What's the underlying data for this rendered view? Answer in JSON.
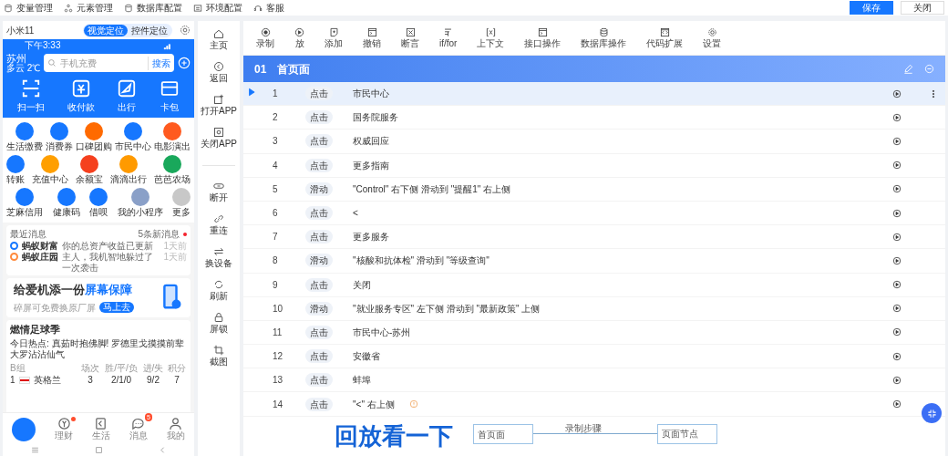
{
  "top_menu": [
    "变量管理",
    "元素管理",
    "数据库配置",
    "环境配置",
    "客服"
  ],
  "top_buttons": [
    {
      "label": "保存",
      "kind": "primary"
    },
    {
      "label": "关闭",
      "kind": "default"
    }
  ],
  "phone": {
    "device": "小米11",
    "locate_modes": [
      {
        "label": "视觉定位",
        "selected": true
      },
      {
        "label": "控件定位",
        "selected": false
      }
    ],
    "status_time": "下午3:33",
    "city": "苏州",
    "weather": "多云 2℃",
    "search_placeholder": "手机充费",
    "search_button": "搜索",
    "quick_actions": [
      "扫一扫",
      "收付款",
      "出行",
      "卡包"
    ],
    "apps": [
      [
        {
          "label": "生活缴费",
          "color": "#1677ff"
        },
        {
          "label": "消费券",
          "color": "#1677ff"
        },
        {
          "label": "口碑团购",
          "color": "#ff6a00"
        },
        {
          "label": "市民中心",
          "color": "#1677ff"
        },
        {
          "label": "电影演出",
          "color": "#ff5a1f"
        }
      ],
      [
        {
          "label": "转账",
          "color": "#1677ff"
        },
        {
          "label": "充值中心",
          "color": "#ff9f00"
        },
        {
          "label": "余额宝",
          "color": "#f5401e"
        },
        {
          "label": "滴滴出行",
          "color": "#ff9a00"
        },
        {
          "label": "芭芭农场",
          "color": "#19a85b"
        }
      ],
      [
        {
          "label": "芝麻信用",
          "color": "#1677ff"
        },
        {
          "label": "健康码",
          "color": "#1677ff"
        },
        {
          "label": "借呗",
          "color": "#1677ff"
        },
        {
          "label": "我的小程序",
          "color": "#8aa0c8"
        },
        {
          "label": "更多",
          "color": "#c8c8c8"
        }
      ]
    ],
    "messages": {
      "title": "最近消息",
      "count": "5条新消息",
      "items": [
        {
          "source": "蚂蚁财富",
          "text": "你的总资产收益已更新",
          "time": "1天前",
          "color": "#1677ff"
        },
        {
          "source": "蚂蚁庄园",
          "text": "主人，我机智地躲过了一次袭击",
          "time": "1天前",
          "color": "#ff8a3d"
        }
      ]
    },
    "banner": {
      "title": "给爱机添一份",
      "title_highlight": "屏幕保障",
      "subtitle": "碎屏可免费换原厂屏",
      "button": "马上去"
    },
    "sports": {
      "title": "燃情足球季",
      "headline": "今日热点: 真茹时抱佛脚! 罗德里戈摸摸前辈大罗沾沾仙气",
      "group": "B组",
      "columns": [
        "场次",
        "胜/平/负",
        "进/失",
        "积分"
      ],
      "rows": [
        {
          "rank": "1",
          "team": "英格兰",
          "values": [
            "3",
            "2/1/0",
            "9/2",
            "7"
          ]
        }
      ]
    },
    "tabbar": [
      {
        "kind": "logo"
      },
      {
        "label": "理财",
        "kind": "coin",
        "unread_dot": true
      },
      {
        "label": "生活",
        "kind": "life",
        "unread_dot": false
      },
      {
        "label": "消息",
        "kind": "chat",
        "unread_dot": false,
        "badge": "5"
      },
      {
        "label": "我的",
        "kind": "person",
        "unread_dot": false
      }
    ]
  },
  "tools": [
    {
      "label": "主页",
      "kind": "home"
    },
    {
      "label": "返回",
      "kind": "back"
    },
    {
      "label": "打开APP",
      "kind": "open"
    },
    {
      "label": "关闭APP",
      "kind": "close"
    },
    {
      "kind": "divider"
    },
    {
      "label": "断开",
      "kind": "disconnect"
    },
    {
      "label": "重连",
      "kind": "link"
    },
    {
      "label": "换设备",
      "kind": "swap"
    },
    {
      "label": "刷新",
      "kind": "refresh"
    },
    {
      "label": "屏锁",
      "kind": "lock"
    },
    {
      "label": "截图",
      "kind": "crop"
    }
  ],
  "toolbar": [
    {
      "label": "录制",
      "kind": "record"
    },
    {
      "label": "放",
      "kind": "play"
    },
    {
      "label": "添加",
      "kind": "add"
    },
    {
      "label": "撤销",
      "kind": "window"
    },
    {
      "label": "断言",
      "kind": "assert"
    },
    {
      "label": "if/for",
      "kind": "branch"
    },
    {
      "label": "上下文",
      "kind": "context"
    },
    {
      "label": "接口操作",
      "kind": "window"
    },
    {
      "label": "数据库操作",
      "kind": "db"
    },
    {
      "label": "代码扩展",
      "kind": "code"
    },
    {
      "label": "设置",
      "kind": "gear"
    }
  ],
  "section": {
    "number": "01",
    "title": "首页面"
  },
  "steps": [
    {
      "number": "1",
      "action": "点击",
      "target": "市民中心",
      "selected": true,
      "warning": false
    },
    {
      "number": "2",
      "action": "点击",
      "target": "国务院服务",
      "selected": false,
      "warning": false
    },
    {
      "number": "3",
      "action": "点击",
      "target": "权威回应",
      "selected": false,
      "warning": false
    },
    {
      "number": "4",
      "action": "点击",
      "target": "更多指南",
      "selected": false,
      "warning": false
    },
    {
      "number": "5",
      "action": "滑动",
      "target": "\"Control\" 右下侧 滑动到 \"提醒1\" 右上侧",
      "selected": false,
      "warning": false
    },
    {
      "number": "6",
      "action": "点击",
      "target": "<",
      "selected": false,
      "warning": false
    },
    {
      "number": "7",
      "action": "点击",
      "target": "更多服务",
      "selected": false,
      "warning": false
    },
    {
      "number": "8",
      "action": "滑动",
      "target": "\"核酸和抗体检\" 滑动到 \"等级查询\"",
      "selected": false,
      "warning": false
    },
    {
      "number": "9",
      "action": "点击",
      "target": "关闭",
      "selected": false,
      "warning": false
    },
    {
      "number": "10",
      "action": "滑动",
      "target": "\"就业服务专区\" 左下侧 滑动到 \"最新政策\" 上侧",
      "selected": false,
      "warning": false
    },
    {
      "number": "11",
      "action": "点击",
      "target": "市民中心-苏州",
      "selected": false,
      "warning": false
    },
    {
      "number": "12",
      "action": "点击",
      "target": "安徽省",
      "selected": false,
      "warning": false
    },
    {
      "number": "13",
      "action": "点击",
      "target": "蚌埠",
      "selected": false,
      "warning": false
    },
    {
      "number": "14",
      "action": "点击",
      "target": "\"<\" 右上侧",
      "selected": false,
      "warning": true
    }
  ],
  "diagram": {
    "nodes": [
      "首页面",
      "页面节点"
    ],
    "edge_label": "录制步骤"
  },
  "caption": "回放看一下"
}
